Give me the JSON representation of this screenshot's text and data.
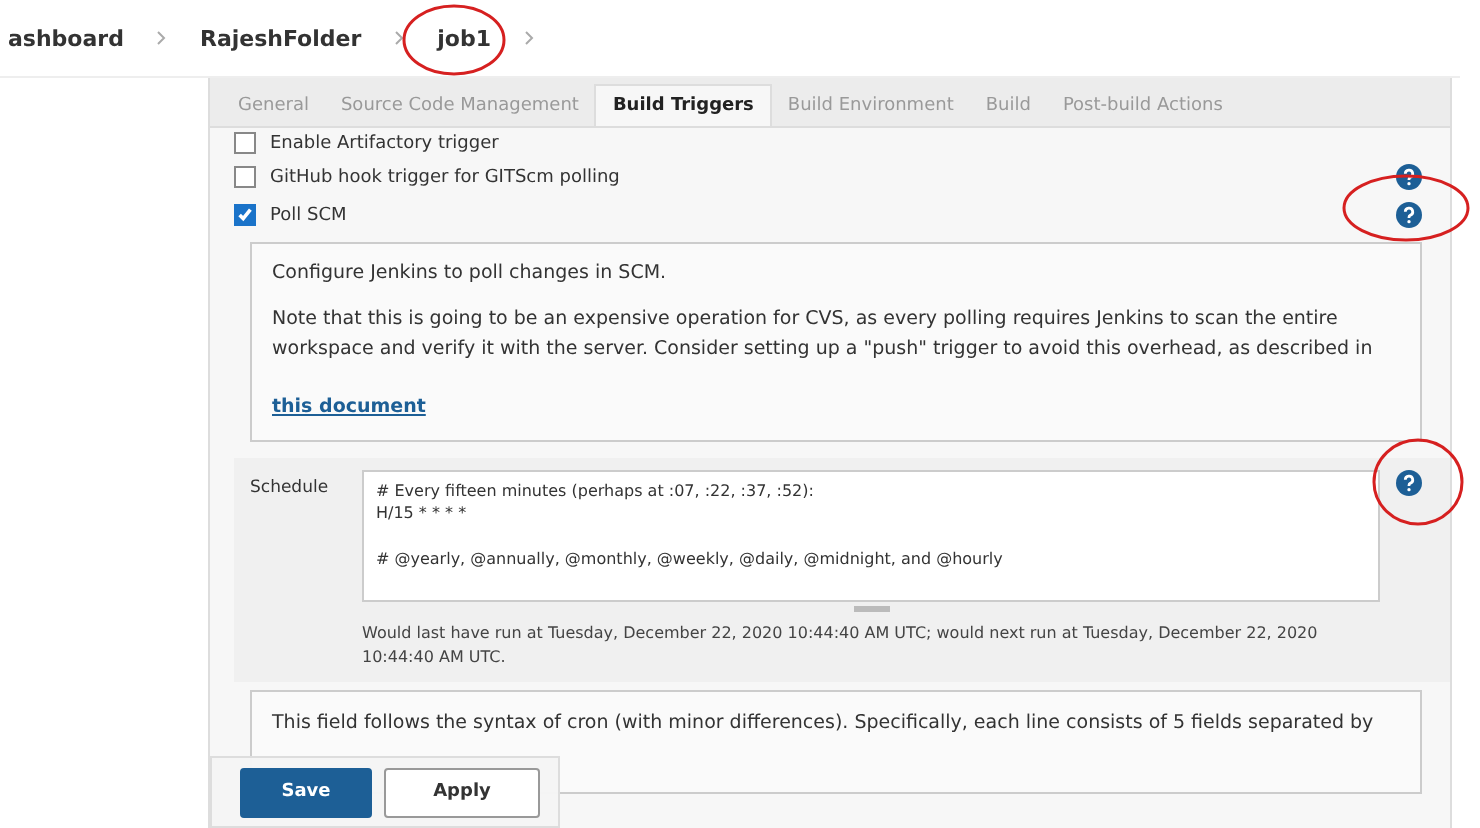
{
  "breadcrumbs": [
    {
      "label": "ashboard"
    },
    {
      "label": "RajeshFolder"
    },
    {
      "label": "job1"
    }
  ],
  "tabs": [
    {
      "label": "General",
      "selected": false
    },
    {
      "label": "Source Code Management",
      "selected": false
    },
    {
      "label": "Build Triggers",
      "selected": true
    },
    {
      "label": "Build Environment",
      "selected": false
    },
    {
      "label": "Build",
      "selected": false
    },
    {
      "label": "Post-build Actions",
      "selected": false
    }
  ],
  "triggers": [
    {
      "label": "Enable Artifactory trigger",
      "checked": false,
      "help": false
    },
    {
      "label": "GitHub hook trigger for GITScm polling",
      "checked": false,
      "help": true
    },
    {
      "label": "Poll SCM",
      "checked": true,
      "help": true
    }
  ],
  "poll_help": {
    "intro": "Configure Jenkins to poll changes in SCM.",
    "note": "Note that this is going to be an expensive operation for CVS, as every polling requires Jenkins to scan the entire workspace and verify it with the server. Consider setting up a \"push\" trigger to avoid this overhead, as described in",
    "link": "this document"
  },
  "schedule": {
    "label": "Schedule",
    "value": "# Every fifteen minutes (perhaps at :07, :22, :37, :52):\nH/15 * * * *\n\n# @yearly, @annually, @monthly, @weekly, @daily, @midnight, and @hourly",
    "status": "Would last have run at Tuesday, December 22, 2020 10:44:40 AM UTC; would next run at Tuesday, December 22, 2020 10:44:40 AM UTC."
  },
  "cron_help": "This field follows the syntax of cron (with minor differences). Specifically, each line consists of 5 fields separated by",
  "buttons": [
    {
      "label": "Save",
      "kind": "primary"
    },
    {
      "label": "Apply",
      "kind": "secondary"
    }
  ]
}
